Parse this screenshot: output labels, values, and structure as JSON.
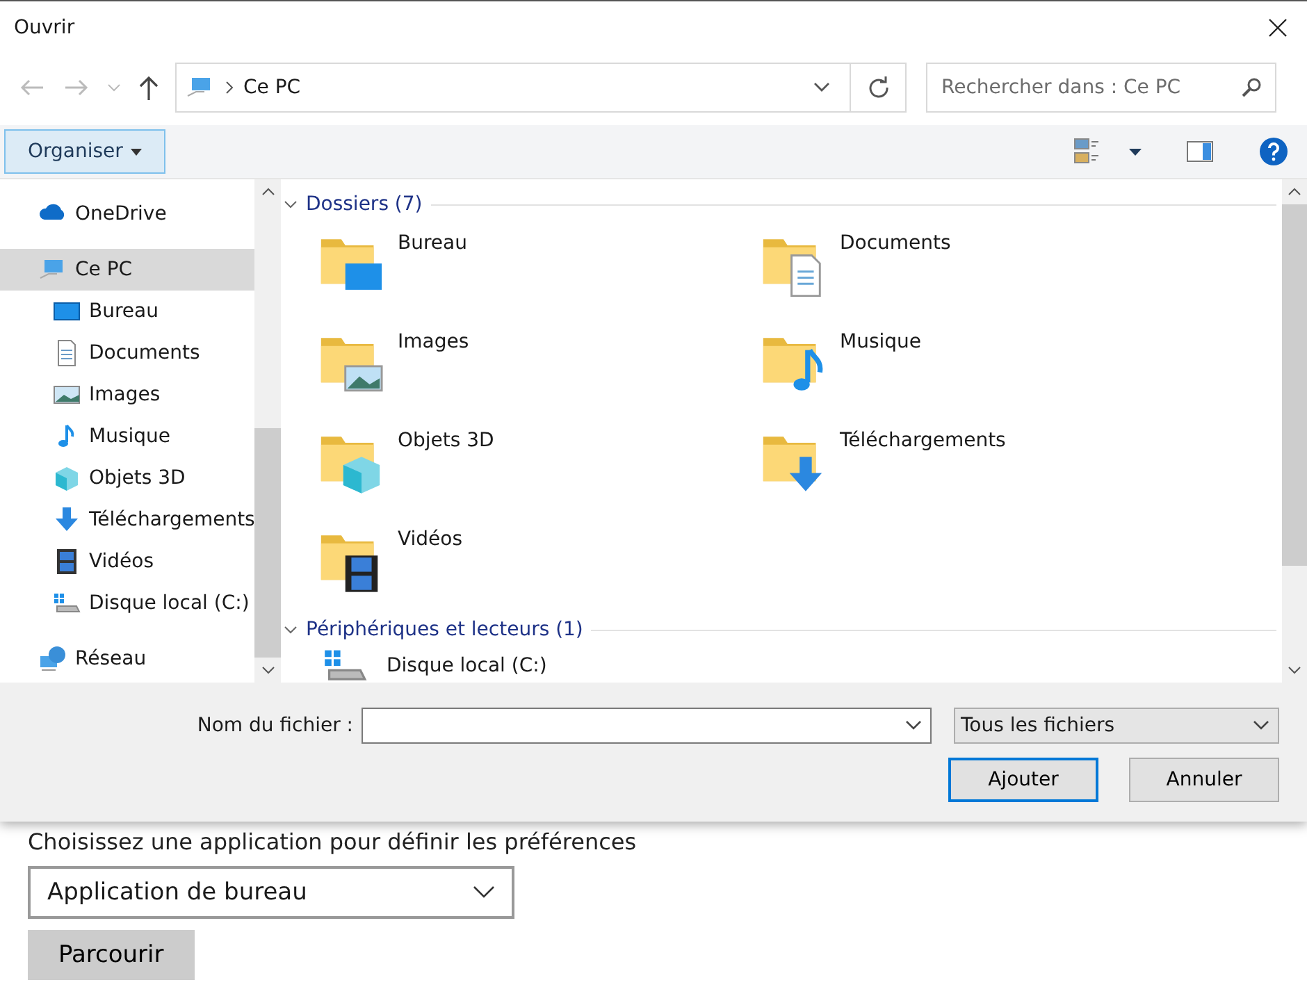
{
  "window": {
    "title": "Ouvrir"
  },
  "address_bar": {
    "path": "Ce PC"
  },
  "search": {
    "placeholder": "Rechercher dans : Ce PC"
  },
  "toolbar": {
    "organize": "Organiser"
  },
  "sidebar": {
    "items": [
      {
        "label": "OneDrive",
        "kind": "cloud",
        "selected": false
      },
      {
        "label": "Ce PC",
        "kind": "pc",
        "selected": true,
        "children": [
          {
            "label": "Bureau",
            "kind": "desktop",
            "selected": false
          },
          {
            "label": "Documents",
            "kind": "documents",
            "selected": false
          },
          {
            "label": "Images",
            "kind": "pictures",
            "selected": false
          },
          {
            "label": "Musique",
            "kind": "music",
            "selected": false
          },
          {
            "label": "Objets 3D",
            "kind": "objects3d",
            "selected": false
          },
          {
            "label": "Téléchargements",
            "kind": "downloads",
            "selected": false
          },
          {
            "label": "Vidéos",
            "kind": "videos",
            "selected": false
          },
          {
            "label": "Disque local (C:)",
            "kind": "drive",
            "selected": false
          }
        ]
      },
      {
        "label": "Réseau",
        "kind": "network",
        "selected": false
      }
    ]
  },
  "groups": [
    {
      "title": "Dossiers (7)",
      "expanded": true,
      "items": [
        {
          "label": "Bureau",
          "kind": "desktop"
        },
        {
          "label": "Documents",
          "kind": "documents"
        },
        {
          "label": "Images",
          "kind": "pictures"
        },
        {
          "label": "Musique",
          "kind": "music"
        },
        {
          "label": "Objets 3D",
          "kind": "objects3d"
        },
        {
          "label": "Téléchargements",
          "kind": "downloads"
        },
        {
          "label": "Vidéos",
          "kind": "videos"
        }
      ]
    },
    {
      "title": "Périphériques et lecteurs (1)",
      "expanded": true,
      "items": [
        {
          "label": "Disque local (C:)",
          "kind": "drive"
        }
      ]
    }
  ],
  "footer": {
    "filename_label": "Nom du fichier :",
    "filter": "Tous les fichiers",
    "buttons": [
      {
        "label": "Ajouter",
        "default": true
      },
      {
        "label": "Annuler",
        "default": false
      }
    ]
  },
  "background_page": {
    "prompt": "Choisissez une application pour définir les préférences",
    "dropdown": "Application de bureau",
    "browse_button": "Parcourir"
  }
}
